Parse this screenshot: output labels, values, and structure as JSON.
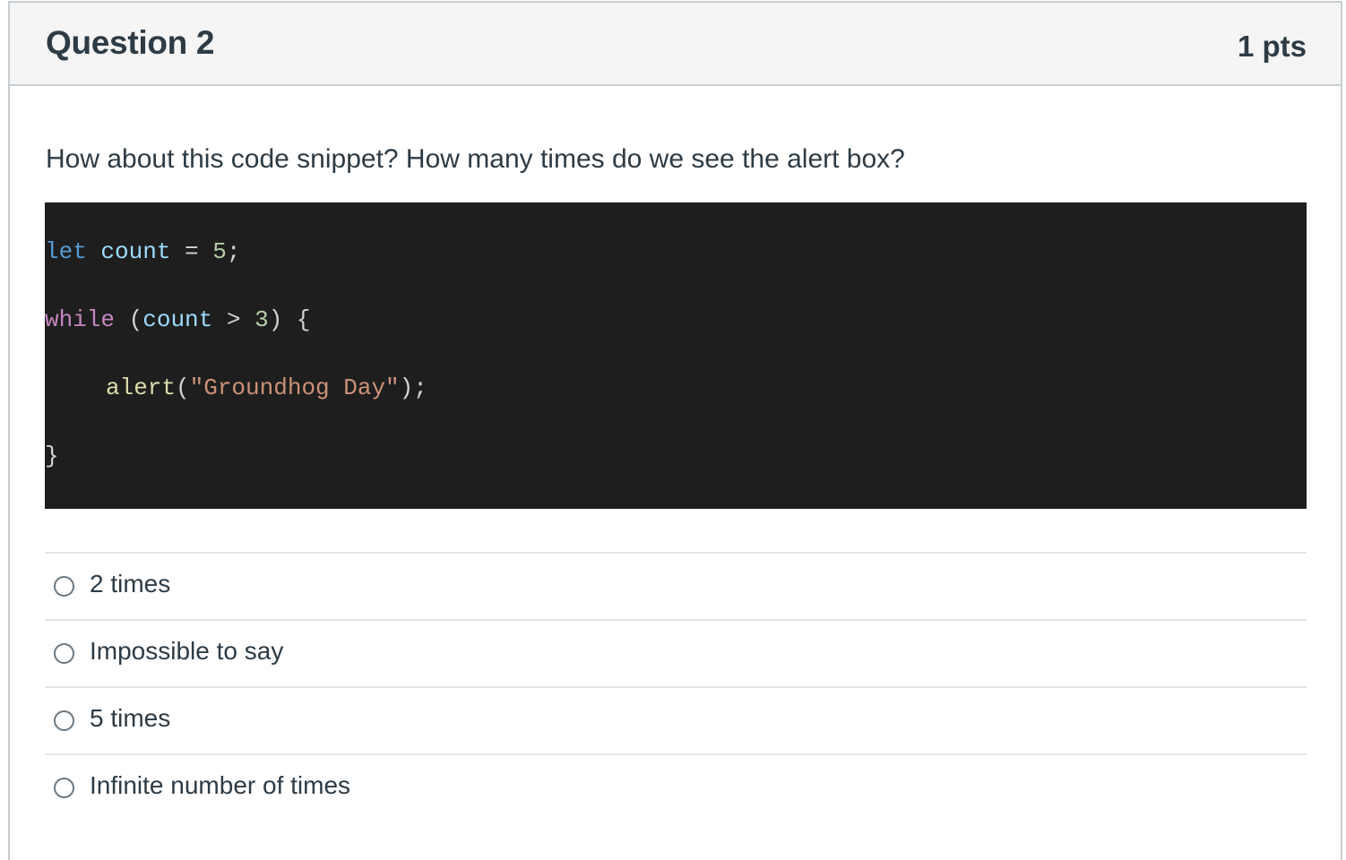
{
  "question": {
    "title": "Question 2",
    "points": "1 pts",
    "prompt": "How about this code snippet? How many times do we see the alert box?"
  },
  "code": {
    "line1": {
      "kw": "let",
      "var": "count",
      "op": "=",
      "num": "5",
      "end": ";"
    },
    "line2": {
      "kw": "while",
      "open": "(",
      "var": "count",
      "op": ">",
      "num": "3",
      "close": ")",
      "brace": "{"
    },
    "line3": {
      "fn": "alert",
      "open": "(",
      "str": "\"Groundhog Day\"",
      "close": ")",
      "end": ";"
    },
    "line4": {
      "brace": "}"
    }
  },
  "answers": [
    {
      "label": "2 times"
    },
    {
      "label": "Impossible to say"
    },
    {
      "label": "5 times"
    },
    {
      "label": "Infinite number of times"
    }
  ],
  "colors": {
    "header_bg": "#f5f5f5",
    "text": "#2d3b45",
    "code_bg": "#1e1e1e",
    "keyword": "#569cd6",
    "control": "#c586c0",
    "variable": "#9cdcfe",
    "string": "#ce9178",
    "function": "#dcdcaa",
    "number": "#b5cea8"
  }
}
